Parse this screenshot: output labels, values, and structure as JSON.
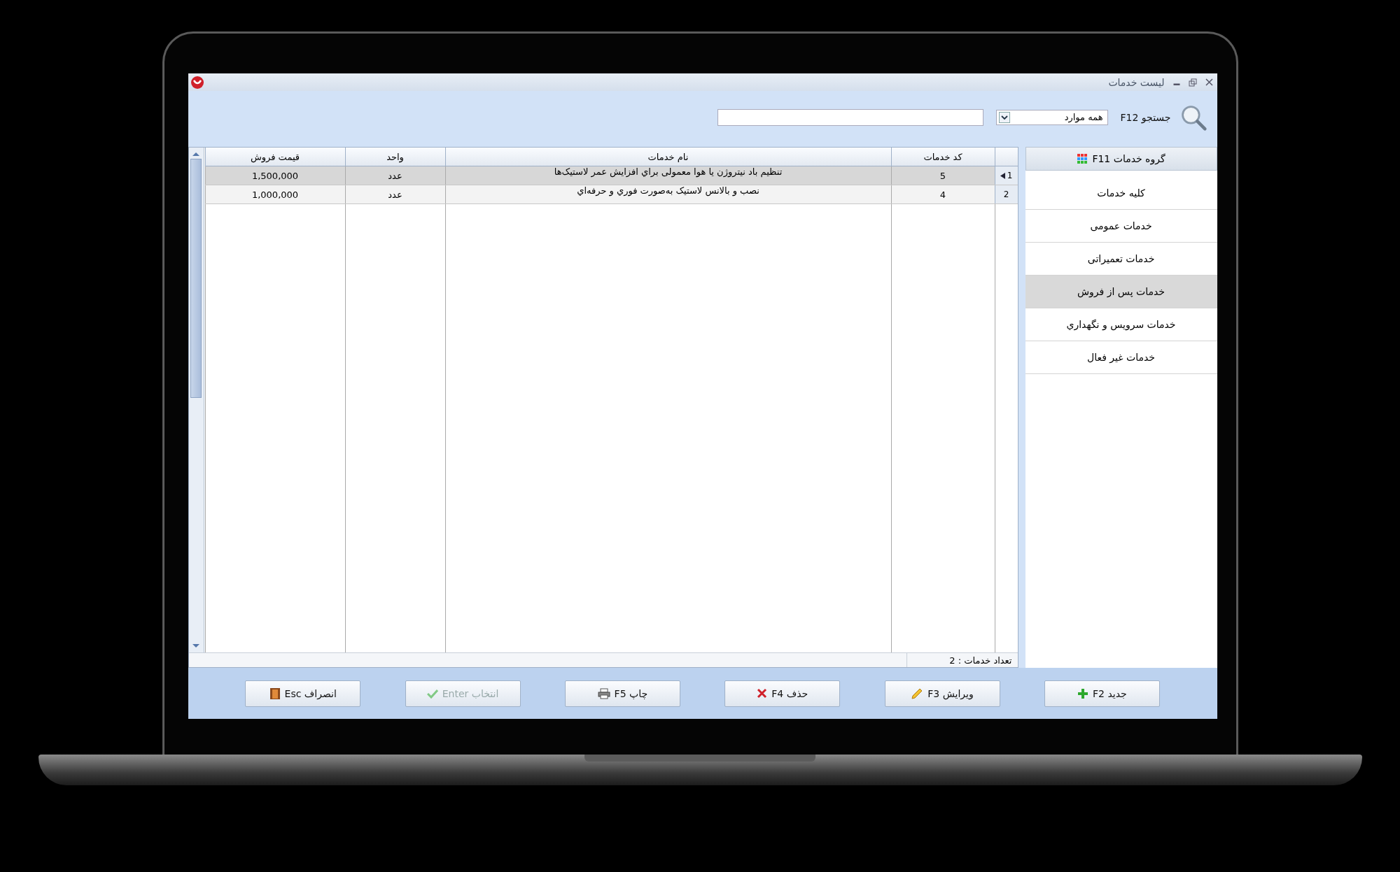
{
  "window": {
    "title": "لیست خدمات"
  },
  "toolbar": {
    "search_label": "جستجو F12",
    "filter": {
      "value": "همه موارد"
    }
  },
  "table": {
    "columns": [
      "کد خدمات",
      "نام خدمات",
      "واحد",
      "قیمت فروش"
    ],
    "rows": [
      {
        "index": "1",
        "selected": true,
        "cells": [
          "5",
          "تنظیم باد نیتروژن یا هوا معمولی براي افزایش عمر لاستیک‌ها",
          "عدد",
          "1,500,000"
        ]
      },
      {
        "index": "2",
        "selected": false,
        "cells": [
          "4",
          "نصب و بالانس لاستیک به‌صورت فوري و حرفه‌اي",
          "عدد",
          "1,000,000"
        ]
      }
    ]
  },
  "status_bar": {
    "count": "تعداد خدمات : 2"
  },
  "sidebar": {
    "header": "گروه خدمات F11",
    "items": [
      {
        "label": "کلیه خدمات",
        "selected": false
      },
      {
        "label": "خدمات عمومی",
        "selected": false
      },
      {
        "label": "خدمات تعمیراتی",
        "selected": false
      },
      {
        "label": "خدمات پس از فروش",
        "selected": true
      },
      {
        "label": "خدمات سرویس و نگهداري",
        "selected": false
      },
      {
        "label": "خدمات غیر فعال",
        "selected": false
      }
    ]
  },
  "buttons": [
    {
      "kind": "new",
      "label": "جدید F2",
      "disabled": false
    },
    {
      "kind": "edit",
      "label": "ویرایش F3",
      "disabled": false
    },
    {
      "kind": "delete",
      "label": "حذف F4",
      "disabled": false
    },
    {
      "kind": "print",
      "label": "چاپ F5",
      "disabled": false
    },
    {
      "kind": "select",
      "label": "انتخاب Enter",
      "disabled": true
    },
    {
      "kind": "cancel",
      "label": "انصراف Esc",
      "disabled": false
    }
  ]
}
